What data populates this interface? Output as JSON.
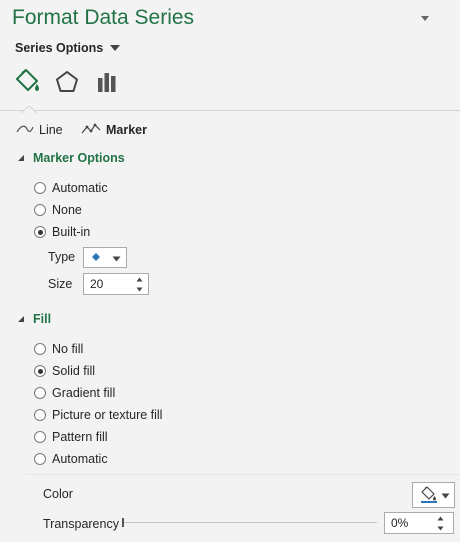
{
  "pane": {
    "title": "Format Data Series",
    "options_label": "Series Options"
  },
  "icon_tabs": [
    {
      "name": "fill-line-icon"
    },
    {
      "name": "effects-icon"
    },
    {
      "name": "series-options-icon"
    }
  ],
  "subtabs": {
    "line": "Line",
    "marker": "Marker"
  },
  "marker_options": {
    "heading": "Marker Options",
    "radios": [
      "Automatic",
      "None",
      "Built-in"
    ],
    "selected": "Built-in",
    "type_label": "Type",
    "size_label": "Size",
    "size_value": "20",
    "marker_color": "#2e75b6"
  },
  "fill": {
    "heading": "Fill",
    "radios": [
      "No fill",
      "Solid fill",
      "Gradient fill",
      "Picture or texture fill",
      "Pattern fill",
      "Automatic"
    ],
    "selected": "Solid fill",
    "color_label": "Color",
    "transparency_label": "Transparency",
    "transparency_value": "0%"
  },
  "colors": {
    "accent": "#217346",
    "background": "#f3f3f3"
  }
}
